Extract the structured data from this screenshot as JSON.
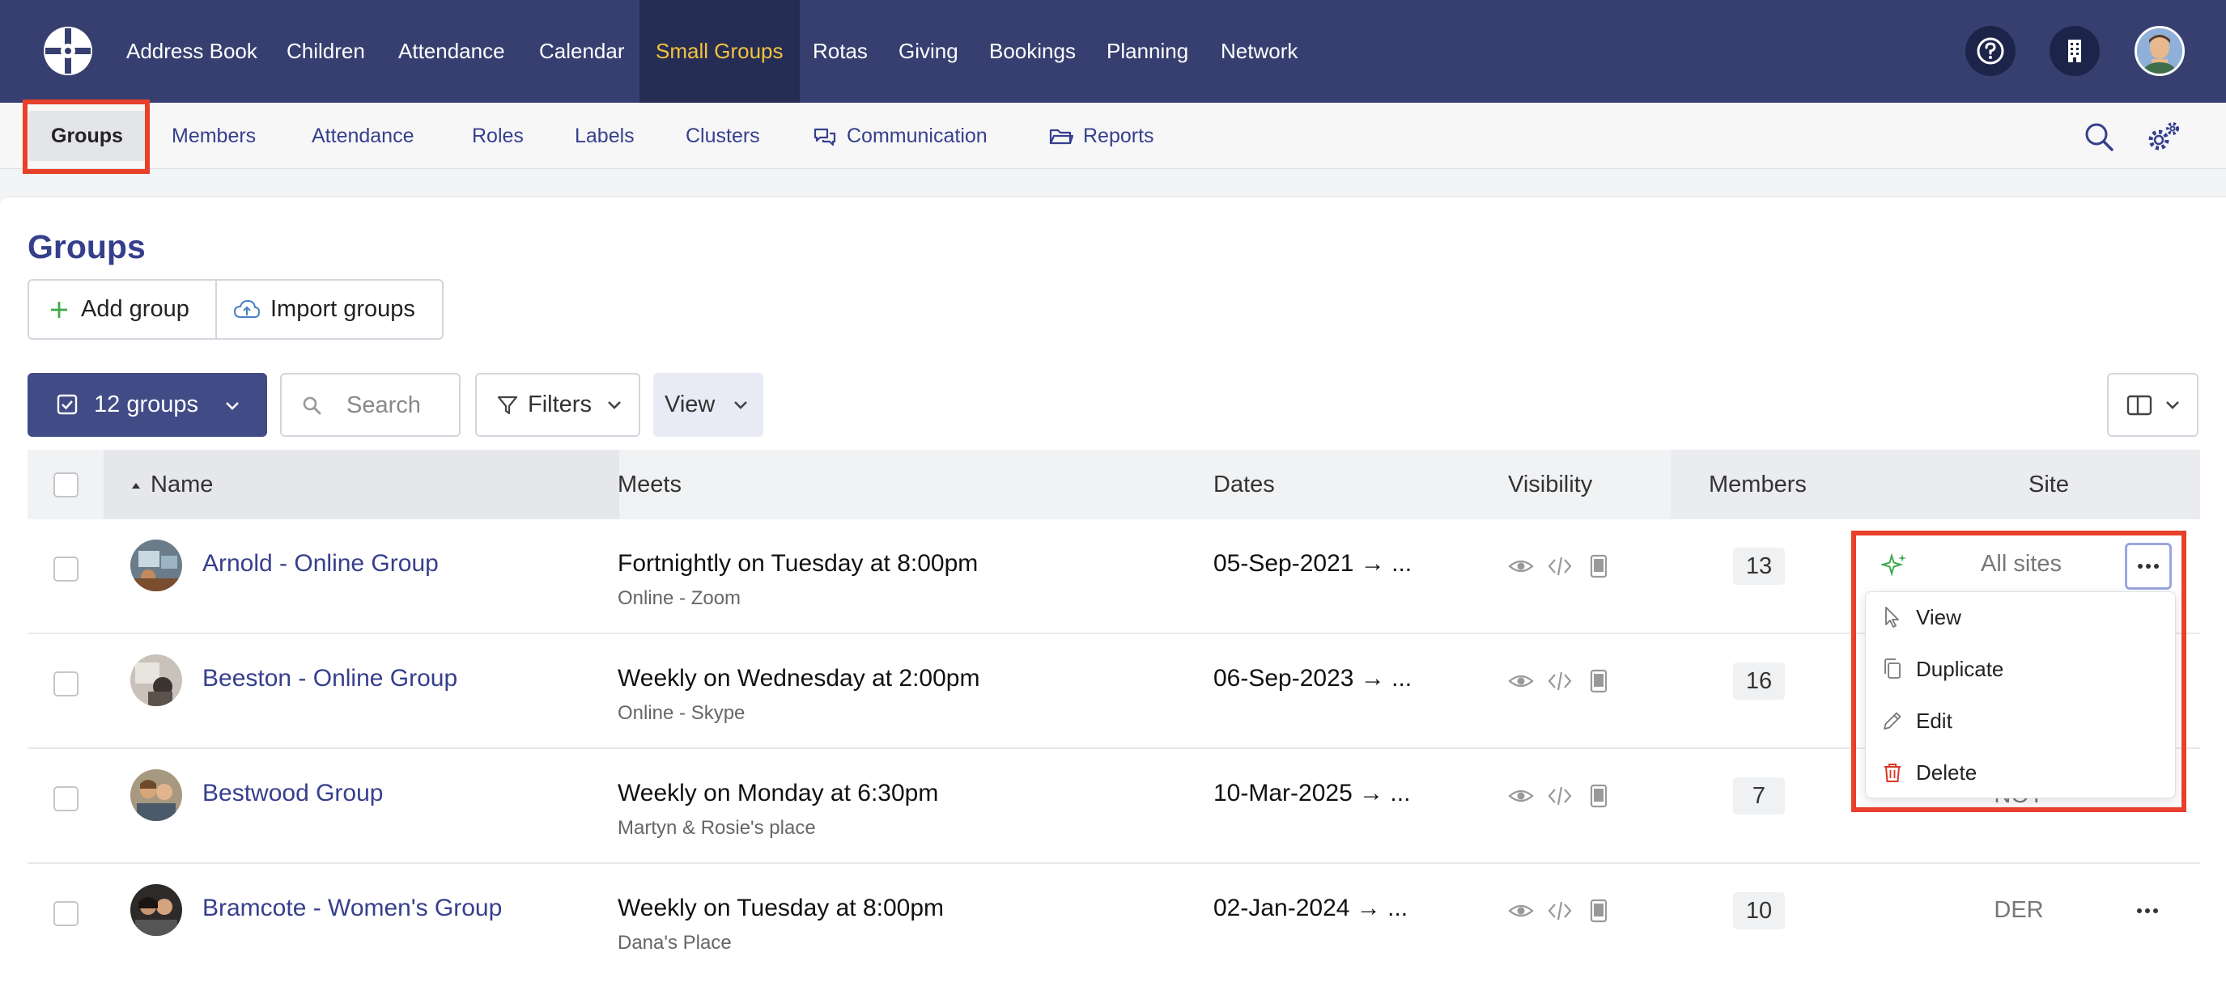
{
  "topnav": {
    "items": [
      "Address Book",
      "Children",
      "Attendance",
      "Calendar",
      "Small Groups",
      "Rotas",
      "Giving",
      "Bookings",
      "Planning",
      "Network"
    ],
    "active": "Small Groups"
  },
  "subnav": {
    "items": [
      "Groups",
      "Members",
      "Attendance",
      "Roles",
      "Labels",
      "Clusters",
      "Communication",
      "Reports"
    ],
    "active": "Groups"
  },
  "page": {
    "title": "Groups",
    "add_label": "Add group",
    "import_label": "Import groups",
    "groups_count_label": "12 groups",
    "search_placeholder": "Search",
    "filters_label": "Filters",
    "view_label": "View"
  },
  "table": {
    "columns": [
      "Name",
      "Meets",
      "Dates",
      "Visibility",
      "Members",
      "Site"
    ],
    "rows": [
      {
        "name": "Arnold - Online Group",
        "meets": "Fortnightly on Tuesday at 8:00pm",
        "place": "Online - Zoom",
        "dates": "05-Sep-2021  →  ...",
        "members": "13",
        "site": "All sites"
      },
      {
        "name": "Beeston - Online Group",
        "meets": "Weekly on Wednesday at 2:00pm",
        "place": "Online - Skype",
        "dates": "06-Sep-2023  →  ...",
        "members": "16",
        "site": ""
      },
      {
        "name": "Bestwood Group",
        "meets": "Weekly on Monday at 6:30pm",
        "place": "Martyn & Rosie's place",
        "dates": "10-Mar-2025  →  ...",
        "members": "7",
        "site": "NOT"
      },
      {
        "name": "Bramcote - Women's Group",
        "meets": "Weekly on Tuesday at 8:00pm",
        "place": "Dana's Place",
        "dates": "02-Jan-2024  →  ...",
        "members": "10",
        "site": "DER"
      }
    ]
  },
  "menu": {
    "items": [
      "View",
      "Duplicate",
      "Edit",
      "Delete"
    ]
  },
  "colors": {
    "nav_bg": "#363f6f",
    "nav_active_text": "#f5c23c",
    "accent": "#363f8c",
    "highlight": "#e8402a",
    "delete": "#d9362b"
  }
}
